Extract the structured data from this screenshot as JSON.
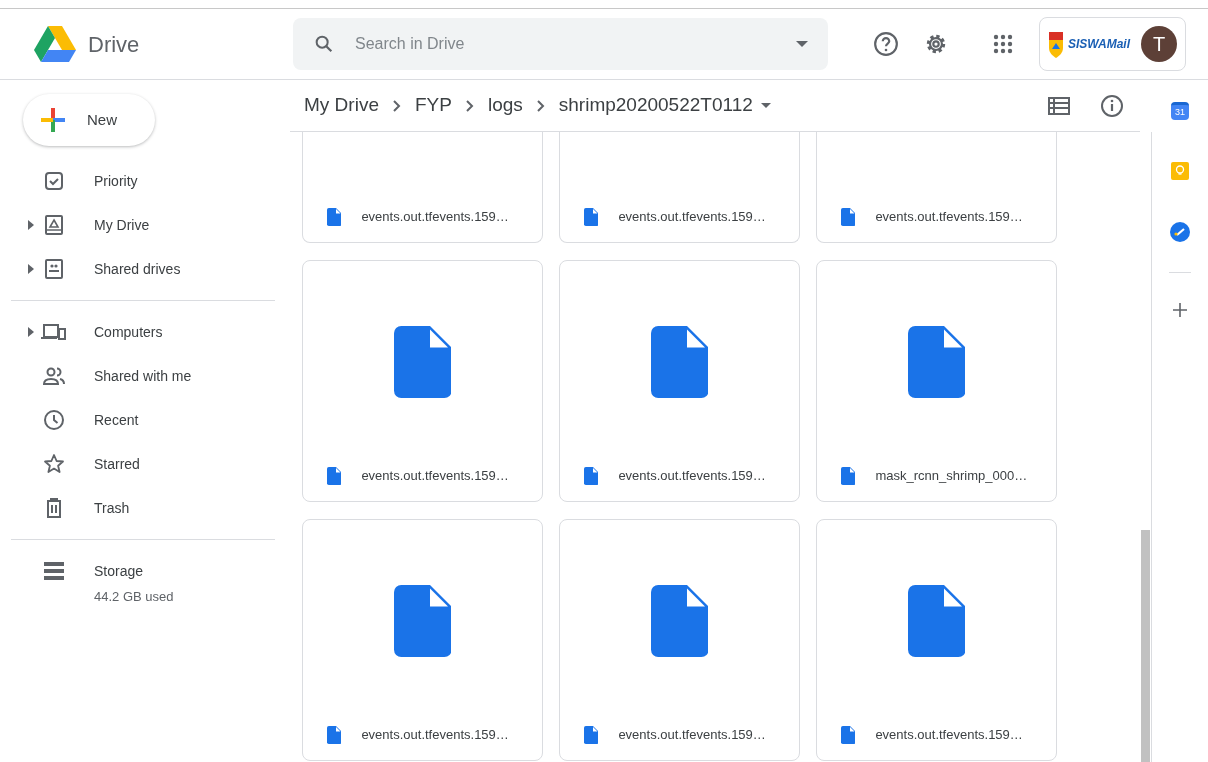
{
  "header": {
    "app_name": "Drive",
    "search": {
      "placeholder": "Search in Drive"
    },
    "account": {
      "brand": "SISWAMail",
      "avatar_letter": "T"
    }
  },
  "new_button": {
    "label": "New"
  },
  "sidebar": {
    "groups": [
      [
        {
          "label": "Priority",
          "expandable": false
        },
        {
          "label": "My Drive",
          "expandable": true
        },
        {
          "label": "Shared drives",
          "expandable": true
        }
      ],
      [
        {
          "label": "Computers",
          "expandable": true
        },
        {
          "label": "Shared with me",
          "expandable": false
        },
        {
          "label": "Recent",
          "expandable": false
        },
        {
          "label": "Starred",
          "expandable": false
        },
        {
          "label": "Trash",
          "expandable": false
        }
      ]
    ],
    "storage": {
      "label": "Storage",
      "used": "44.2 GB used"
    }
  },
  "breadcrumb": [
    "My Drive",
    "FYP",
    "logs",
    "shrimp20200522T0112"
  ],
  "files": [
    {
      "name": "events.out.tfevents.159…",
      "kind": "clipped"
    },
    {
      "name": "events.out.tfevents.159…",
      "kind": "clipped"
    },
    {
      "name": "events.out.tfevents.159…",
      "kind": "clipped"
    },
    {
      "name": "events.out.tfevents.159…",
      "kind": "full"
    },
    {
      "name": "events.out.tfevents.159…",
      "kind": "full"
    },
    {
      "name": "mask_rcnn_shrimp_000…",
      "kind": "full"
    },
    {
      "name": "events.out.tfevents.159…",
      "kind": "full"
    },
    {
      "name": "events.out.tfevents.159…",
      "kind": "full"
    },
    {
      "name": "events.out.tfevents.159…",
      "kind": "full"
    }
  ],
  "side_panel": {
    "calendar_day": "31"
  }
}
